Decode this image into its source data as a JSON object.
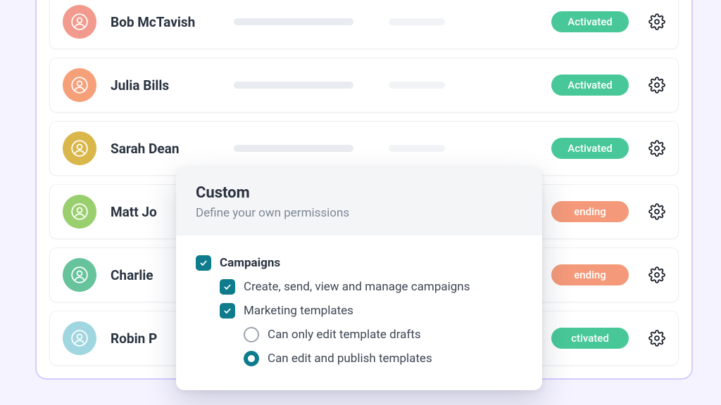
{
  "users": [
    {
      "name": "Bob McTavish",
      "status": "Activated",
      "status_kind": "activated",
      "color": "#f39a8e"
    },
    {
      "name": "Julia Bills",
      "status": "Activated",
      "status_kind": "activated",
      "color": "#f6a07a"
    },
    {
      "name": "Sarah Dean",
      "status": "Activated",
      "status_kind": "activated",
      "color": "#d9b74a"
    },
    {
      "name": "Matt Jo",
      "status": "ending",
      "status_kind": "pending",
      "color": "#9acf6f"
    },
    {
      "name": "Charlie",
      "status": "ending",
      "status_kind": "pending",
      "color": "#66c39b"
    },
    {
      "name": "Robin P",
      "status": "ctivated",
      "status_kind": "activated",
      "color": "#9fd6e0"
    }
  ],
  "popover": {
    "title": "Custom",
    "subtitle": "Define your own permissions",
    "section_label": "Campaigns",
    "items": {
      "create": "Create, send, view and manage campaigns",
      "templates": "Marketing templates",
      "draft_only": "Can only edit template drafts",
      "publish": "Can edit and publish templates"
    }
  }
}
